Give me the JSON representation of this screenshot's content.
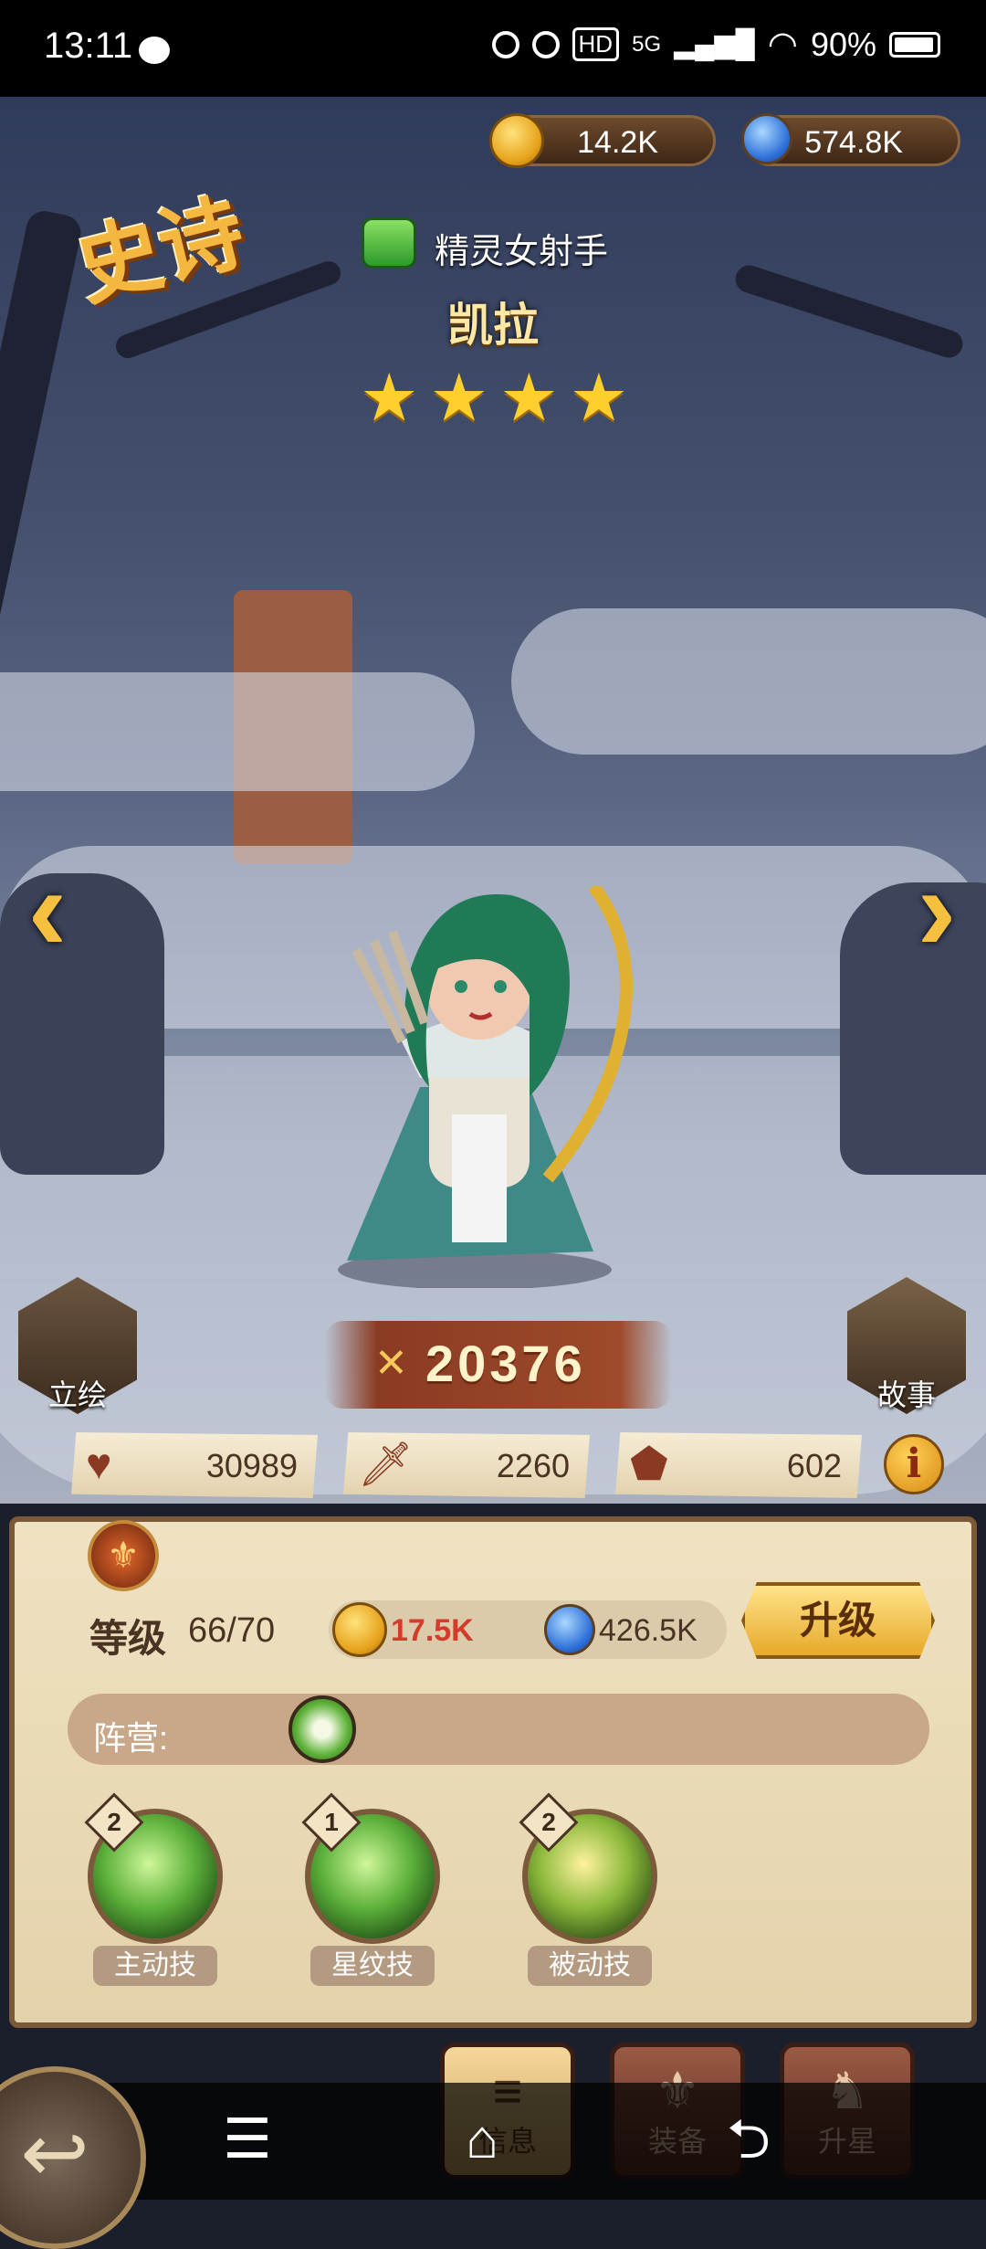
{
  "status_bar": {
    "time": "13:11",
    "signal": "5G",
    "battery": "90%"
  },
  "currencies": {
    "gold": "14.2K",
    "exp_potion": "574.8K"
  },
  "hero": {
    "rarity": "史诗",
    "class_name": "精灵女射手",
    "name": "凯拉",
    "stars": 4,
    "power": "20376"
  },
  "side_buttons": {
    "portrait": "立绘",
    "story": "故事"
  },
  "stats": {
    "hp": "30989",
    "attack": "2260",
    "defense": "602"
  },
  "panel": {
    "level_label": "等级",
    "level_value": "66/70",
    "cost_gold": "17.5K",
    "cost_exp": "426.5K",
    "upgrade_label": "升级",
    "faction_label": "阵营:"
  },
  "skills": [
    {
      "label": "主动技",
      "level": "2"
    },
    {
      "label": "星纹技",
      "level": "1"
    },
    {
      "label": "被动技",
      "level": "2"
    }
  ],
  "tabs": [
    {
      "label": "信息",
      "active": true
    },
    {
      "label": "装备",
      "active": false
    },
    {
      "label": "升星",
      "active": false
    }
  ],
  "colors": {
    "accent_gold": "#f4b840",
    "cost_red": "#d33b2a",
    "panel_bg": "#efe2c2"
  }
}
